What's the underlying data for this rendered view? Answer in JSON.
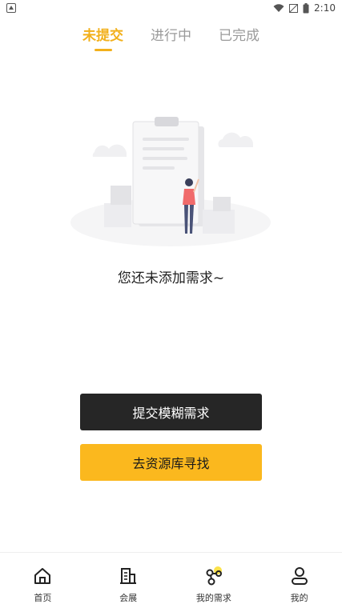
{
  "status_bar": {
    "time": "2:10"
  },
  "tabs": [
    {
      "label": "未提交",
      "active": true
    },
    {
      "label": "进行中",
      "active": false
    },
    {
      "label": "已完成",
      "active": false
    }
  ],
  "empty_state": {
    "message": "您还未添加需求~"
  },
  "actions": {
    "submit_label": "提交模糊需求",
    "browse_label": "去资源库寻找"
  },
  "bottom_nav": [
    {
      "label": "首页",
      "icon": "home-icon"
    },
    {
      "label": "会展",
      "icon": "building-icon"
    },
    {
      "label": "我的需求",
      "icon": "nodes-icon"
    },
    {
      "label": "我的",
      "icon": "person-icon"
    }
  ],
  "colors": {
    "accent": "#f2b01b",
    "primary_button": "#262626",
    "secondary_button": "#fbb81e",
    "muted_text": "#9a9a9a"
  }
}
